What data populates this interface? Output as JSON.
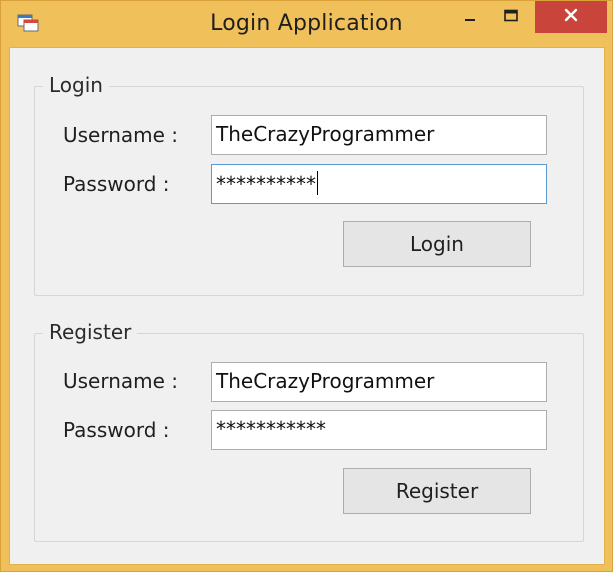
{
  "window": {
    "title": "Login Application",
    "controls": {
      "minimize_icon": "minimize-icon",
      "maximize_icon": "maximize-icon",
      "close_icon": "close-icon"
    },
    "colors": {
      "frame": "#f0c05a",
      "close": "#c9453b",
      "client": "#f0f0f0"
    }
  },
  "login": {
    "legend": "Login",
    "username_label": "Username :",
    "username_value": "TheCrazyProgrammer",
    "password_label": "Password :",
    "password_value": "**********",
    "button_label": "Login"
  },
  "register": {
    "legend": "Register",
    "username_label": "Username :",
    "username_value": "TheCrazyProgrammer",
    "password_label": "Password :",
    "password_value": "***********",
    "button_label": "Register"
  }
}
